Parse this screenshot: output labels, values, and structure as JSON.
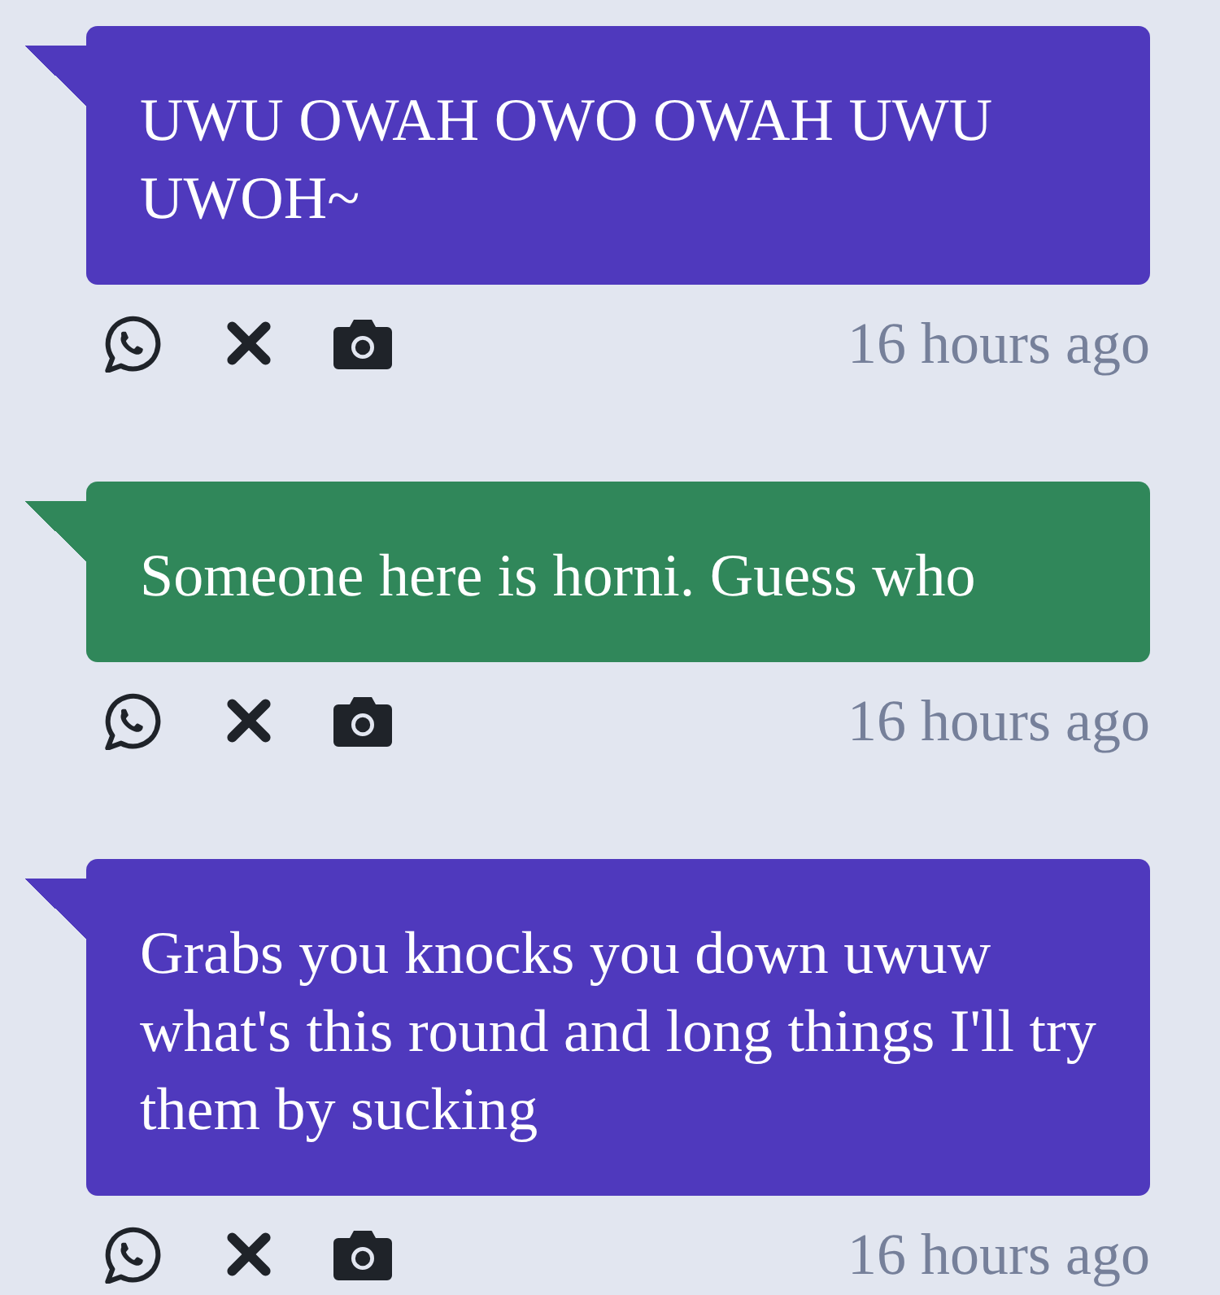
{
  "messages": [
    {
      "text": "UWU OWAH OWO OWAH UWU UWOH~",
      "color": "#4f39bd",
      "time": "16 hours ago"
    },
    {
      "text": "Someone here is horni. Guess who",
      "color": "#30875a",
      "time": "16 hours ago"
    },
    {
      "text": "Grabs you knocks you down uwuw what's this round and long things I'll try them by sucking",
      "color": "#4f39bd",
      "time": "16 hours ago"
    }
  ]
}
